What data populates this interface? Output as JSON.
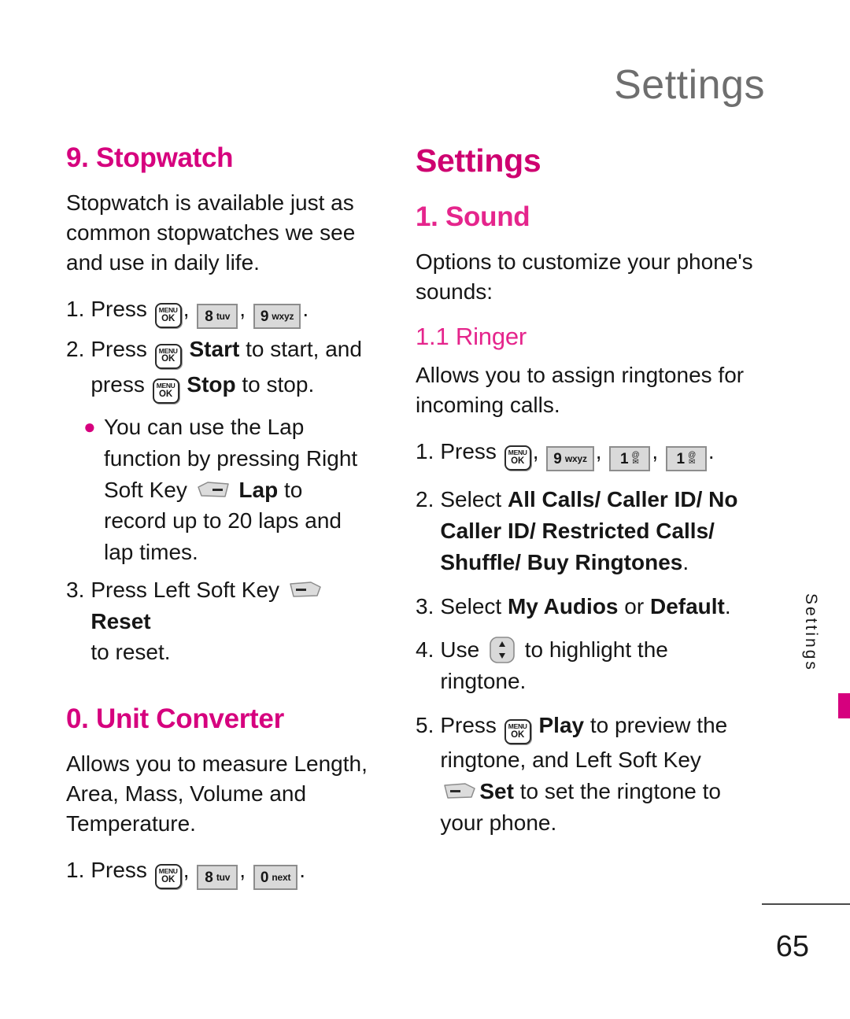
{
  "header": {
    "running_title": "Settings"
  },
  "left_column": {
    "stopwatch": {
      "title": "9. Stopwatch",
      "intro": "Stopwatch is available just as common stopwatches we see and use in daily life.",
      "step1": {
        "num": "1.",
        "press": "Press",
        "keys": [
          "menu-ok",
          "8 tuv",
          "9 wxyz"
        ],
        "period": "."
      },
      "step2": {
        "num": "2.",
        "press": "Press",
        "start_label": "Start",
        "start_tail": "to start, and",
        "press2": "press",
        "stop_label": "Stop",
        "stop_tail": "to stop."
      },
      "bullet": {
        "line1": "You can use the Lap",
        "line2": "function by pressing Right",
        "line3_pre": "Soft Key",
        "lap_label": "Lap",
        "line3_post": "to",
        "line4": "record up to 20 laps and",
        "line5": "lap times."
      },
      "step3": {
        "num": "3.",
        "pre": "Press Left Soft Key",
        "reset_label": "Reset",
        "post": "to reset."
      }
    },
    "unit_converter": {
      "title": "0. Unit Converter",
      "intro": "Allows you to measure Length, Area, Mass, Volume and Temperature.",
      "step1": {
        "num": "1.",
        "press": "Press",
        "keys": [
          "menu-ok",
          "8 tuv",
          "0 next"
        ],
        "period": "."
      }
    }
  },
  "right_column": {
    "chapter_title": "Settings",
    "sound": {
      "title": "1. Sound",
      "intro": "Options to customize your phone's sounds:"
    },
    "ringer": {
      "title": "1.1 Ringer",
      "intro": "Allows you to assign ringtones for incoming calls.",
      "step1": {
        "num": "1.",
        "press": "Press",
        "keys": [
          "menu-ok",
          "9 wxyz",
          "1 @mail",
          "1 @mail"
        ],
        "period": "."
      },
      "step2": {
        "num": "2.",
        "select": "Select",
        "options_line1": "All Calls/ Caller ID/ No",
        "options_line2": "Caller ID/ Restricted Calls/",
        "options_line3": "Shuffle/ Buy Ringtones",
        "period": "."
      },
      "step3": {
        "num": "3.",
        "select": "Select",
        "option_a": "My Audios",
        "conj": "or",
        "option_b": "Default",
        "period": "."
      },
      "step4": {
        "num": "4.",
        "use": "Use",
        "tail": "to highlight the",
        "line2": "ringtone."
      },
      "step5": {
        "num": "5.",
        "press": "Press",
        "play_label": "Play",
        "play_tail": "to preview the",
        "line2": "ringtone, and Left Soft Key",
        "set_label": "Set",
        "set_tail": "to set the ringtone to",
        "line4": "your phone."
      }
    }
  },
  "side_tab": {
    "label": "Settings"
  },
  "footer": {
    "page_number": "65"
  },
  "keys": {
    "menu_ok": {
      "line1": "MENU",
      "line2": "OK"
    },
    "k8": {
      "digit": "8",
      "letters": "tuv"
    },
    "k9": {
      "digit": "9",
      "letters": "wxyz"
    },
    "k0": {
      "digit": "0",
      "letters": "next"
    },
    "k1": {
      "digit": "1",
      "top": "@",
      "bottom": "✉"
    }
  },
  "colors": {
    "heading_magenta": "#D6007E",
    "subheading_magenta": "#E5258C",
    "header_gray": "#6E6E6E",
    "key_gray": "#D9D9D9"
  }
}
